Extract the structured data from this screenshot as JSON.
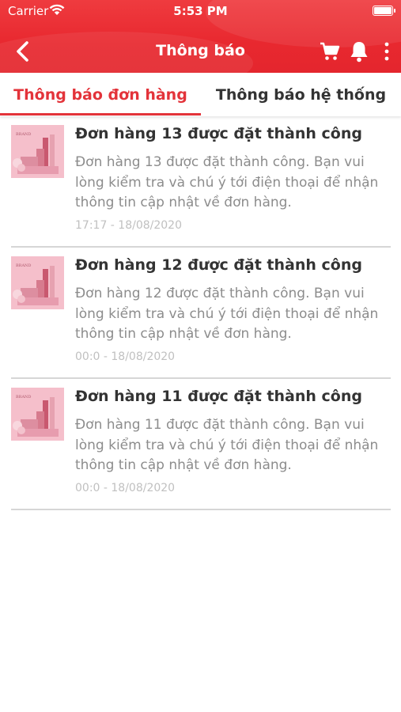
{
  "status_bar": {
    "carrier": "Carrier",
    "time": "5:53 PM"
  },
  "header": {
    "title": "Thông báo",
    "icons": [
      "back-icon",
      "cart-icon",
      "bell-icon",
      "more-vertical-icon"
    ]
  },
  "tabs": [
    {
      "label": "Thông báo đơn hàng",
      "active": true
    },
    {
      "label": "Thông báo hệ thống",
      "active": false
    }
  ],
  "notifications": [
    {
      "title": "Đơn hàng 13 được đặt thành công",
      "body": "Đơn hàng 13 được đặt thành công. Bạn vui lòng kiểm tra và chú ý tới điện thoại để nhận thông tin cập nhật về đơn hàng.",
      "time": "17:17 - 18/08/2020",
      "thumbnail_text": "BRAND"
    },
    {
      "title": "Đơn hàng 12 được đặt thành công",
      "body": "Đơn hàng 12 được đặt thành công. Bạn vui lòng kiểm tra và chú ý tới điện thoại để nhận thông tin cập nhật về đơn hàng.",
      "time": "00:0 - 18/08/2020",
      "thumbnail_text": "BRAND"
    },
    {
      "title": "Đơn hàng 11 được đặt thành công",
      "body": "Đơn hàng 11 được đặt thành công. Bạn vui lòng kiểm tra và chú ý tới điện thoại để nhận thông tin cập nhật về đơn hàng.",
      "time": "00:0 - 18/08/2020",
      "thumbnail_text": "BRAND"
    }
  ],
  "colors": {
    "header_red": "#e8282f",
    "accent_red": "#e3333a",
    "title_text": "#333333",
    "body_text": "#8c8c8c",
    "time_text": "#c0c0c0",
    "divider": "#d6d6d6"
  }
}
